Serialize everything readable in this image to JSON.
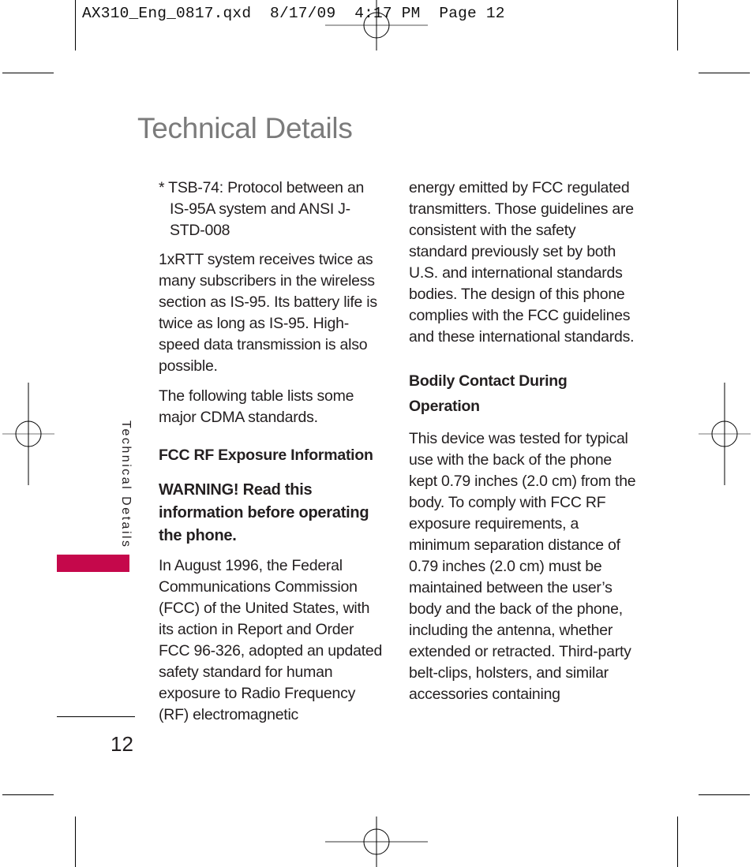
{
  "print_slug": {
    "filename": "AX310_Eng_0817.qxd",
    "date": "8/17/09",
    "time": "4:17 PM",
    "page_label": "Page 12"
  },
  "page": {
    "title": "Technical Details",
    "side_tab_label": "Technical Details",
    "accent_color": "#c5084b",
    "page_number": "12"
  },
  "left_column": {
    "bullet": "* TSB-74: Protocol between an IS-95A system and ANSI J-STD-008",
    "para1": "1xRTT system receives twice as many subscribers in the wireless section as IS-95. Its battery life is twice as long as IS-95. High-speed data transmission is also possible.",
    "para2": "The following table lists some major CDMA standards.",
    "heading": "FCC RF Exposure Information",
    "warning": "WARNING! Read this information before operating the phone.",
    "para3": "In August 1996, the Federal Communications Commission (FCC) of the United States, with its action in Report and Order FCC 96-326, adopted an updated safety standard for human exposure to Radio Frequency (RF) electromagnetic"
  },
  "right_column": {
    "para1": "energy emitted by FCC regulated transmitters. Those guidelines are consistent with the safety standard previously set by both U.S. and international standards bodies. The design of this phone complies with the FCC guidelines and these international standards.",
    "heading": "Bodily Contact During Operation",
    "para2": "This device was tested for typical use with the back of the phone kept 0.79 inches (2.0 cm) from the body. To comply with FCC RF exposure requirements, a minimum separation distance of 0.79 inches (2.0 cm) must be maintained between the user’s body and the back of the phone, including the antenna, whether extended or retracted. Third-party belt-clips, holsters, and similar accessories containing"
  }
}
